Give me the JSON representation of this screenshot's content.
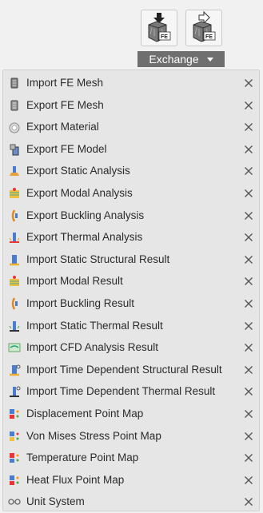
{
  "toolbar": {
    "import_icon": "import-fe-icon",
    "export_icon": "export-fe-icon",
    "exchange_label": "Exchange",
    "badge": "FE"
  },
  "menu": {
    "items": [
      {
        "label": "Import FE Mesh",
        "icon": "import-fe-mesh-icon"
      },
      {
        "label": "Export FE Mesh",
        "icon": "export-fe-mesh-icon"
      },
      {
        "label": "Export Material",
        "icon": "export-material-icon"
      },
      {
        "label": "Export FE Model",
        "icon": "export-fe-model-icon"
      },
      {
        "label": "Export Static Analysis",
        "icon": "static-analysis-icon"
      },
      {
        "label": "Export Modal Analysis",
        "icon": "modal-analysis-icon"
      },
      {
        "label": "Export Buckling Analysis",
        "icon": "buckling-analysis-icon"
      },
      {
        "label": "Export Thermal Analysis",
        "icon": "thermal-analysis-icon"
      },
      {
        "label": "Import Static Structural Result",
        "icon": "static-structural-result-icon"
      },
      {
        "label": "Import Modal Result",
        "icon": "modal-result-icon"
      },
      {
        "label": "Import Buckling Result",
        "icon": "buckling-result-icon"
      },
      {
        "label": "Import Static Thermal Result",
        "icon": "static-thermal-result-icon"
      },
      {
        "label": "Import CFD Analysis Result",
        "icon": "cfd-result-icon"
      },
      {
        "label": "Import Time Dependent Structural Result",
        "icon": "time-structural-result-icon"
      },
      {
        "label": "Import Time Dependent Thermal Result",
        "icon": "time-thermal-result-icon"
      },
      {
        "label": "Displacement Point Map",
        "icon": "displacement-map-icon"
      },
      {
        "label": "Von Mises Stress Point Map",
        "icon": "von-mises-map-icon"
      },
      {
        "label": "Temperature Point Map",
        "icon": "temperature-map-icon"
      },
      {
        "label": "Heat Flux Point Map",
        "icon": "heat-flux-map-icon"
      },
      {
        "label": "Unit System",
        "icon": "unit-system-icon"
      }
    ]
  },
  "colors": {
    "menu_bg": "#e6e6e6",
    "exchange_bg": "#6f6f6f",
    "close_x": "#555555"
  }
}
